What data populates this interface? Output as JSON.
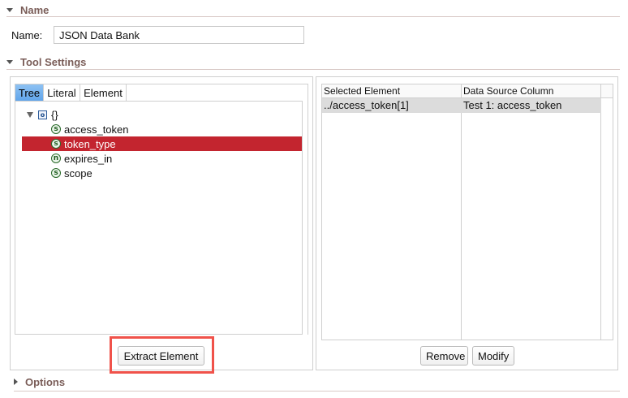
{
  "sections": {
    "name": {
      "label": "Name",
      "expanded": true
    },
    "tool_settings": {
      "label": "Tool Settings",
      "expanded": true
    },
    "options": {
      "label": "Options",
      "expanded": false
    }
  },
  "name_field": {
    "label": "Name:",
    "value": "JSON Data Bank"
  },
  "tabs": [
    {
      "label": "Tree",
      "active": true
    },
    {
      "label": "Literal",
      "active": false
    },
    {
      "label": "Element",
      "active": false
    }
  ],
  "tree": {
    "root": {
      "label": "{}",
      "badge": "o"
    },
    "children": [
      {
        "label": "access_token",
        "badge": "s",
        "selected": false
      },
      {
        "label": "token_type",
        "badge": "s",
        "selected": true
      },
      {
        "label": "expires_in",
        "badge": "n",
        "selected": false
      },
      {
        "label": "scope",
        "badge": "s",
        "selected": false
      }
    ]
  },
  "buttons": {
    "extract": "Extract Element",
    "remove": "Remove",
    "modify": "Modify"
  },
  "table": {
    "columns": [
      "Selected Element",
      "Data Source Column"
    ],
    "rows": [
      [
        "../access_token[1]",
        "Test 1: access_token"
      ]
    ]
  },
  "colors": {
    "selection": "#c3252f",
    "highlight_border": "#f0524a",
    "section_label": "#7a5d58",
    "active_tab": "#5fa4ea"
  }
}
